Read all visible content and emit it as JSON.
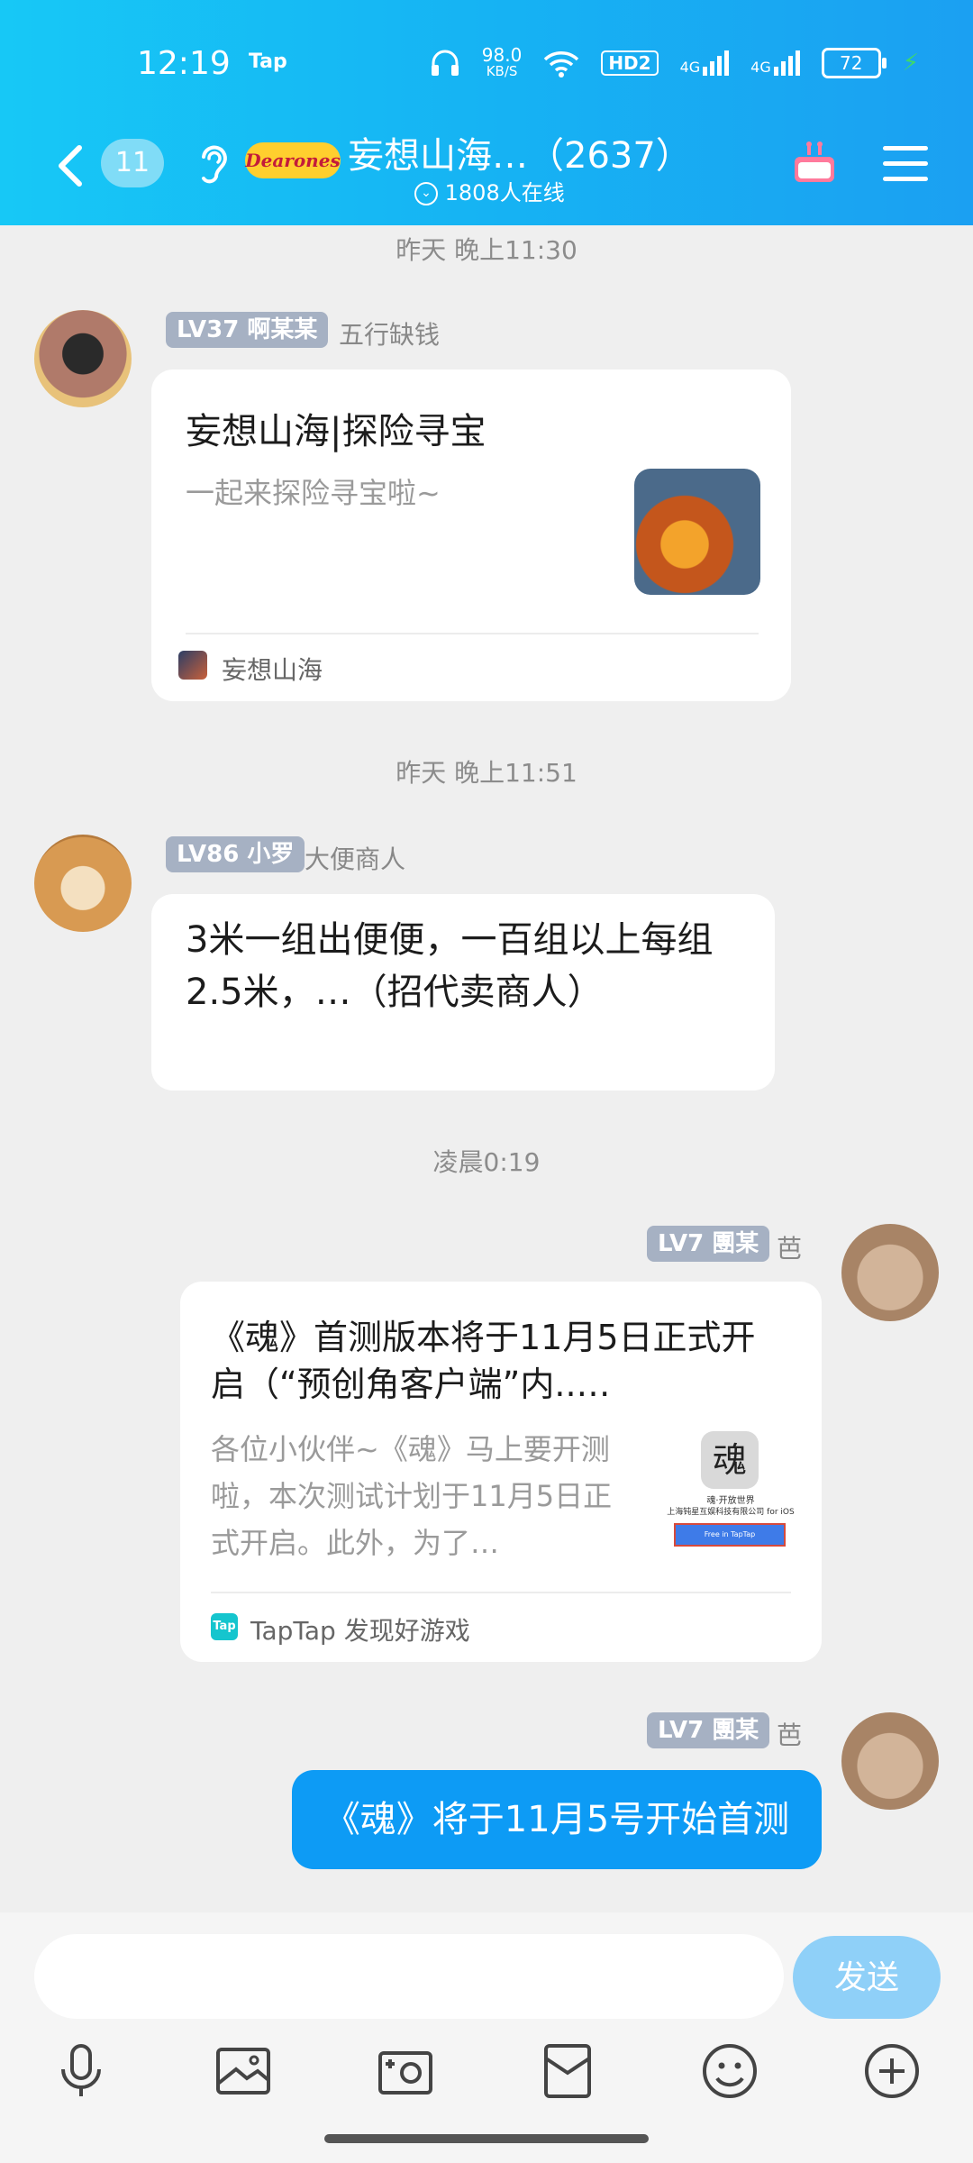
{
  "status_bar": {
    "time": "12:19",
    "app_label": "Tap",
    "net_speed_value": "98.0",
    "net_speed_unit": "KB/S",
    "hd_badge": "HD2",
    "signal1": "4G",
    "signal2": "4G",
    "battery": "72"
  },
  "header": {
    "unread_count": "11",
    "group_logo_text": "Dearones",
    "title": "妄想山海…（2637）",
    "online_text": "1808人在线"
  },
  "messages": [
    {
      "timestamp": "昨天 晚上11:30",
      "level": "LV37",
      "nickname": "啊某某",
      "tag": "五行缺钱",
      "card": {
        "title": "妄想山海|探险寻宝",
        "desc": "一起来探险寻宝啦~",
        "footer": "妄想山海"
      }
    },
    {
      "timestamp": "昨天 晚上11:51",
      "level": "LV86",
      "nickname": "小罗",
      "tag": "大便商人",
      "text": "3米一组出便便，一百组以上每组2.5米，…（招代卖商人）"
    },
    {
      "timestamp": "凌晨0:19",
      "level": "LV7",
      "nickname": "團某",
      "tag": "芭",
      "card": {
        "title": "《魂》首测版本将于11月5日正式开启（“预创角客户端”内..…",
        "desc": "各位小伙伴~《魂》马上要开测啦，本次测试计划于11月5日正式开启。此外，为了…",
        "thumb_caption": "魂·开放世界",
        "thumb_company": "上海钝星互娱科技有限公司 for iOS",
        "thumb_button": "Free in TapTap",
        "footer_badge": "Tap",
        "footer": "TapTap 发现好游戏"
      }
    },
    {
      "level": "LV7",
      "nickname": "團某",
      "tag": "芭",
      "text": "《魂》将于11月5号开始首测"
    }
  ],
  "input": {
    "placeholder": "",
    "send_label": "发送"
  },
  "toolbar": [
    "mic-icon",
    "image-icon",
    "camera-icon",
    "pocket-icon",
    "emoji-icon",
    "plus-icon"
  ]
}
